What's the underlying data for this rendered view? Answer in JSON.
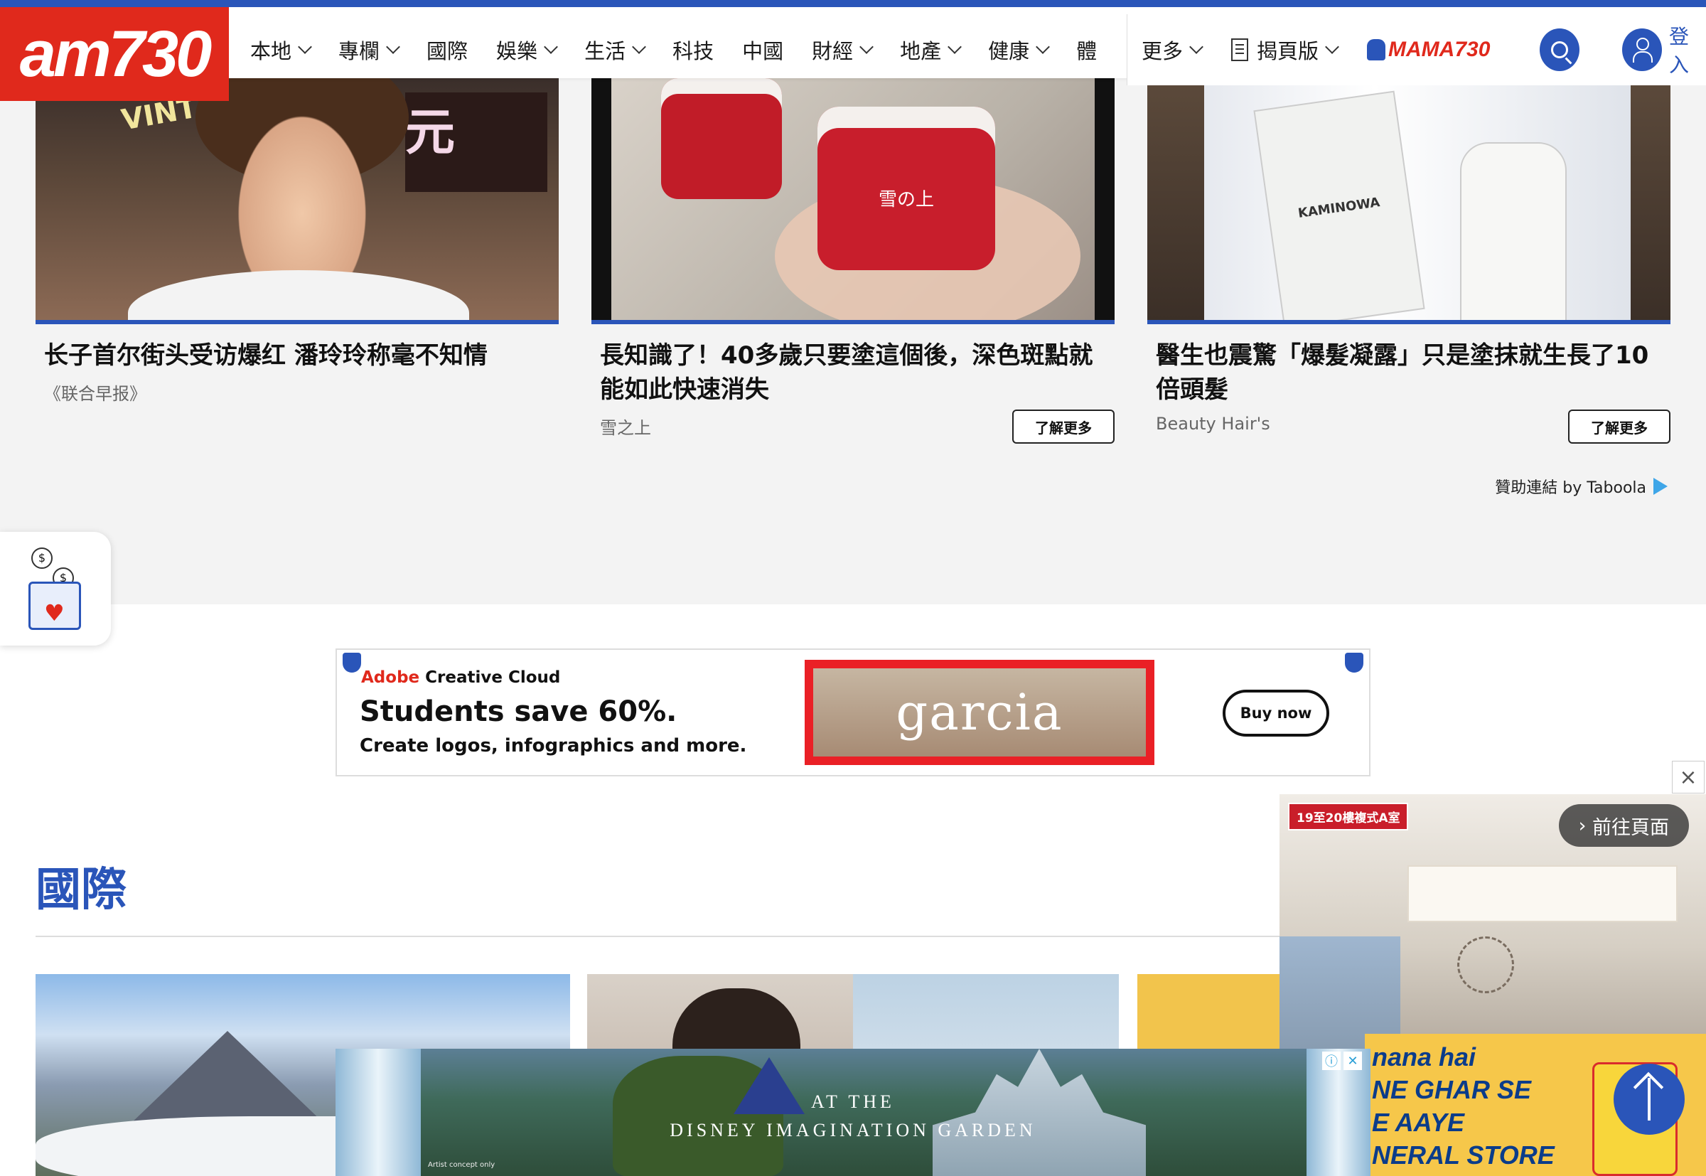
{
  "nav": {
    "logo": "am730",
    "items": [
      {
        "label": "本地",
        "dropdown": true
      },
      {
        "label": "專欄",
        "dropdown": true
      },
      {
        "label": "國際",
        "dropdown": false
      },
      {
        "label": "娛樂",
        "dropdown": true
      },
      {
        "label": "生活",
        "dropdown": true
      },
      {
        "label": "科技",
        "dropdown": false
      },
      {
        "label": "中國",
        "dropdown": false
      },
      {
        "label": "財經",
        "dropdown": true
      },
      {
        "label": "地產",
        "dropdown": true
      },
      {
        "label": "健康",
        "dropdown": true
      },
      {
        "label": "體",
        "dropdown": false
      }
    ],
    "more_label": "更多",
    "epaper_label": "揭頁版",
    "mama_label": "MAMA730",
    "login_label": "登入"
  },
  "sponsored": {
    "cards": [
      {
        "title": "长子首尔街头受访爆红 潘玲玲称毫不知情",
        "source": "《联合早报》",
        "button": ""
      },
      {
        "title": "長知識了！40多歲只要塗這個後，深色斑點就能如此快速消失",
        "source": "雪之上",
        "button": "了解更多"
      },
      {
        "title": "醫生也震驚「爆髮凝露」只是塗抹就生長了10倍頭髮",
        "source": "Beauty Hair's",
        "button": "了解更多"
      }
    ],
    "image_text": {
      "sign_1": "VINTAGE",
      "sign_2": "元",
      "jar": "雪の上",
      "box": "KAMINOWA"
    },
    "attribution": "贊助連結 by Taboola"
  },
  "adobe_ad": {
    "brand_red": "Adobe",
    "brand_rest": " Creative Cloud",
    "headline": "Students save 60%.",
    "sub": "Create logos, infographics and more.",
    "art_text": "garcia",
    "button": "Buy now"
  },
  "section": {
    "title": "國際"
  },
  "video_popup": {
    "tag": "19至20樓複式A室",
    "goto": "前往頁面",
    "lays_text": [
      "nana hai",
      "NE GHAR SE",
      "E AAYE",
      "NERAL STORE"
    ]
  },
  "disney_ad": {
    "line1": "AT THE",
    "line2": "DISNEY IMAGINATION GARDEN",
    "concept": "Artist concept only"
  },
  "colors": {
    "brand_blue": "#2a55b9",
    "brand_red": "#e0291c"
  }
}
